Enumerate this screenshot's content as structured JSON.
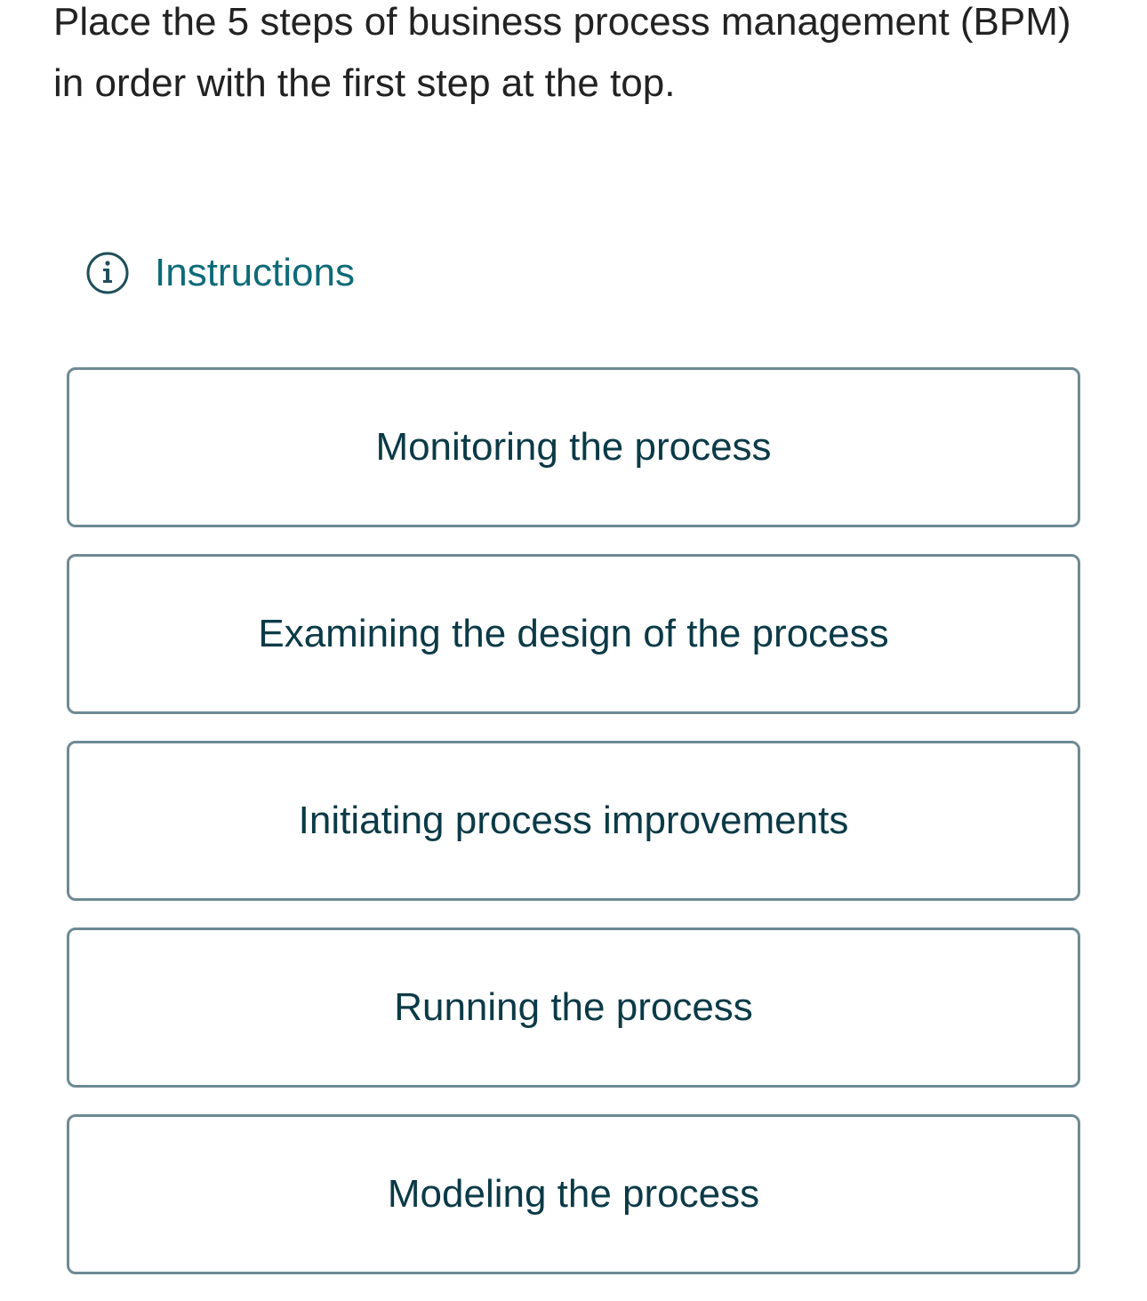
{
  "question": {
    "text": "Place the 5 steps of business process management (BPM) in order with the first step at the top."
  },
  "instructions": {
    "label": "Instructions",
    "icon": "info-circle-icon",
    "color": "#0e6a78"
  },
  "steps": {
    "items": [
      {
        "label": "Monitoring the process"
      },
      {
        "label": "Examining the design of the process"
      },
      {
        "label": "Initiating process improvements"
      },
      {
        "label": "Running the process"
      },
      {
        "label": "Modeling the process"
      }
    ],
    "border_color": "#6e8a93",
    "text_color": "#0b3a47"
  }
}
